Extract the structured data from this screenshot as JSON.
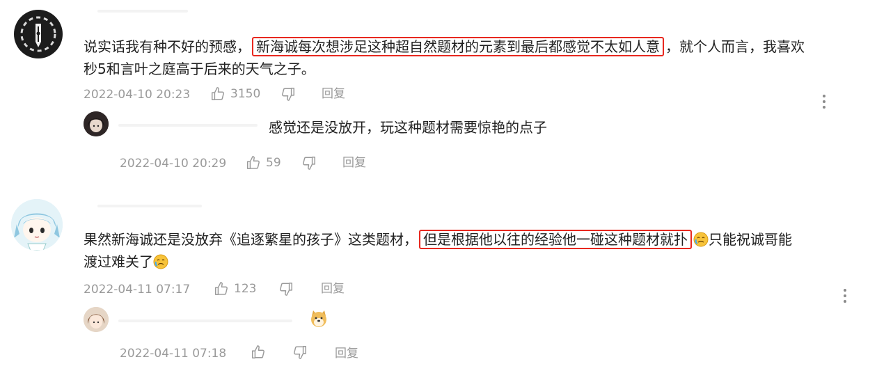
{
  "comments": [
    {
      "avatar_icon": "pen-nib-avatar-icon",
      "text_before": "说实话我有种不好的预感，",
      "text_highlight": "新海诚每次想涉足这种超自然题材的元素到最后都感觉不太如人意",
      "text_after_line1": "，就个人而言，我喜欢",
      "text_line2": "秒5和言叶之庭高于后来的天气之子。",
      "timestamp": "2022-04-10 20:23",
      "likes": "3150",
      "reply_label": "回复",
      "reply": {
        "avatar_icon": "dark-hair-avatar-icon",
        "text": "感觉还是没放开，玩这种题材需要惊艳的点子",
        "timestamp": "2022-04-10 20:29",
        "likes": "59",
        "reply_label": "回复"
      }
    },
    {
      "avatar_icon": "anime-girl-avatar-icon",
      "text_before": "果然新海诚还是没放弃《追逐繁星的孩子》这类题材，",
      "text_highlight": "但是根据他以往的经验他一碰这种题材就扑",
      "text_after_line1": "只能祝诚哥能",
      "text_line2": "渡过难关了",
      "timestamp": "2022-04-11 07:17",
      "likes": "123",
      "reply_label": "回复",
      "reply": {
        "avatar_icon": "brown-hair-avatar-icon",
        "emoji_icon": "doge-emoji-icon",
        "timestamp": "2022-04-11 07:18",
        "reply_label": "回复"
      }
    }
  ],
  "colors": {
    "highlight_border": "#e8281f",
    "meta_text": "#9a9a9a",
    "body_text": "#222222"
  }
}
